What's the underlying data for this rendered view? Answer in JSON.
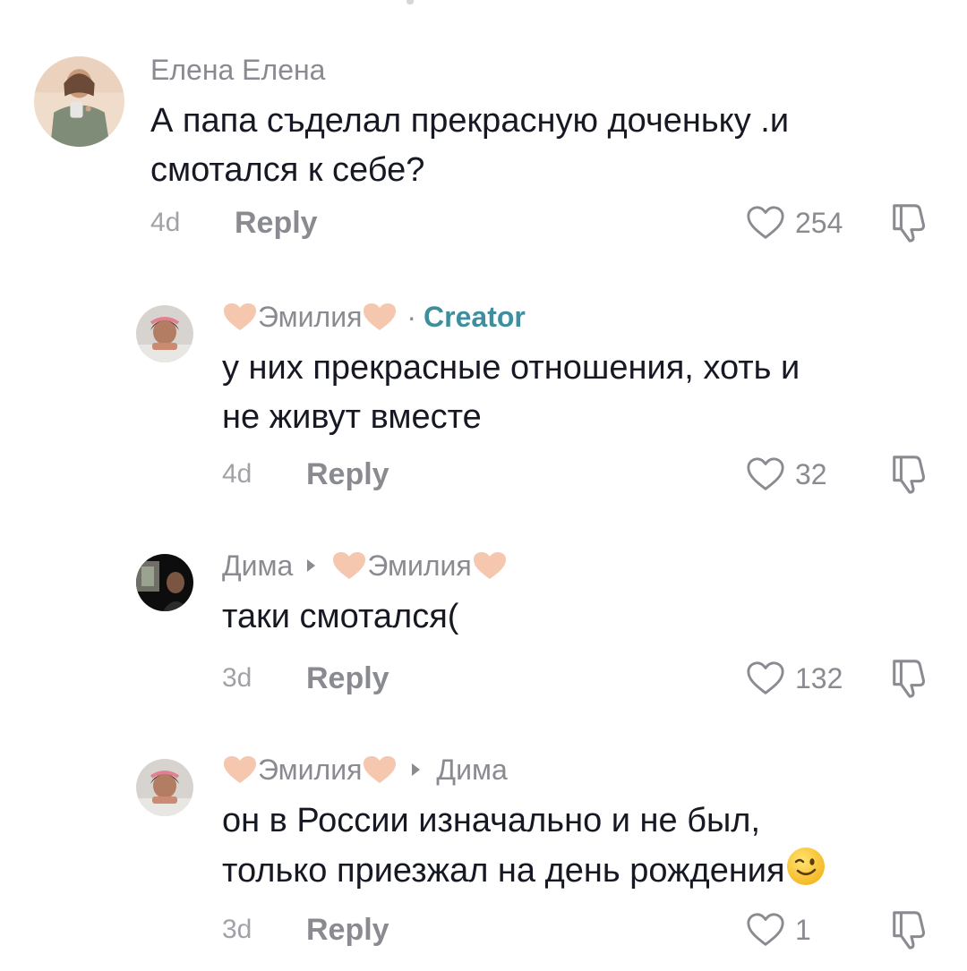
{
  "comments": [
    {
      "author": "Елена Елена",
      "text_lines": [
        "А папа съделал прекрасную доченьку .и",
        "смотался к себе?"
      ],
      "time": "4d",
      "reply_label": "Reply",
      "likes": "254"
    },
    {
      "author": "Эмилия",
      "badge": "Creator",
      "text_lines": [
        "у них прекрасные отношения, хоть и",
        "не живут вместе"
      ],
      "time": "4d",
      "reply_label": "Reply",
      "likes": "32"
    },
    {
      "author": "Дима",
      "reply_to": "Эмилия",
      "text_lines": [
        "таки смотался("
      ],
      "time": "3d",
      "reply_label": "Reply",
      "likes": "132"
    },
    {
      "author": "Эмилия",
      "reply_to": "Дима",
      "text_lines": [
        "он в России изначально и не был,",
        "только приезжал на день рождения"
      ],
      "time": "3d",
      "reply_label": "Reply",
      "likes": "1"
    }
  ],
  "icons": {
    "like": "heart-outline-icon",
    "dislike": "thumbs-down-icon",
    "name_decoration": "peach-heart-emoji",
    "text_emoji": "winking-face-emoji",
    "reply_arrow": "play-triangle-icon"
  },
  "colors": {
    "text": "#161823",
    "secondary": "#8a8b91",
    "creator": "#3f8e9d",
    "heart_emoji": "#f3c6ad"
  }
}
